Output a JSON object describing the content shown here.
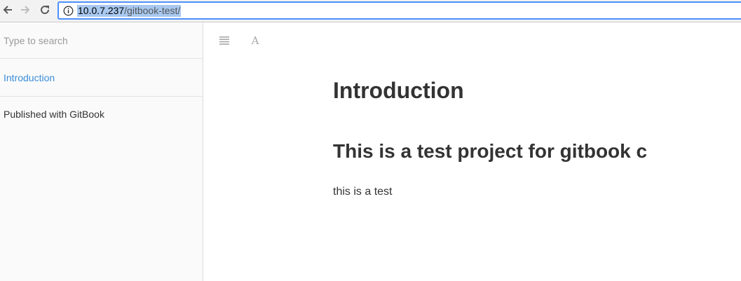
{
  "browser": {
    "url_host": "10.0.7.237",
    "url_path": "/gitbook-test/",
    "icons": {
      "back": "back-arrow-icon",
      "forward": "forward-arrow-icon",
      "reload": "reload-icon",
      "info": "info-icon"
    }
  },
  "sidebar": {
    "search_placeholder": "Type to search",
    "items": [
      {
        "label": "Introduction",
        "active": true
      },
      {
        "label": "Published with GitBook",
        "active": false
      }
    ]
  },
  "header": {
    "toc_icon": "menu-icon",
    "font_label": "A"
  },
  "content": {
    "title": "Introduction",
    "subtitle": "This is a test project for gitbook c",
    "paragraph": "this is a test"
  },
  "colors": {
    "accent": "#3a8ed8",
    "url_selection": "#a8c8f0",
    "omnibox_border": "#4d90fe",
    "sidebar_bg": "#fafafa"
  }
}
